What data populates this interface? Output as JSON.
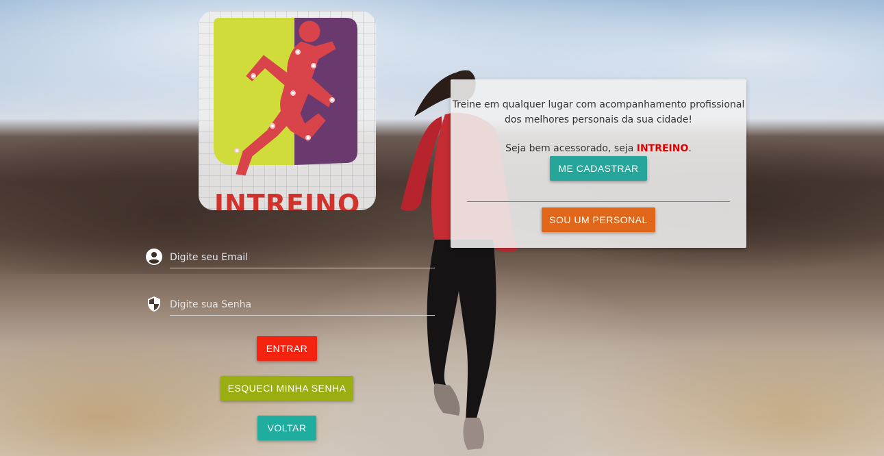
{
  "brand": {
    "logo_text": "INTREINO"
  },
  "card": {
    "tagline": "Treine em qualquer lugar com acompanhamento profissional dos melhores personais da sua cidade!",
    "welcome_prefix": "Seja bem acessorado, seja ",
    "welcome_brand": "INTREINO",
    "welcome_suffix": ".",
    "signup_label": "ME CADASTRAR",
    "personal_label": "SOU UM PERSONAL"
  },
  "login": {
    "email_placeholder": "Digite seu Email",
    "password_placeholder": "Digite sua Senha",
    "email_value": "",
    "password_value": "",
    "enter_label": "ENTRAR",
    "forgot_label": "ESQUECI MINHA SENHA",
    "back_label": "VOLTAR"
  },
  "icons": {
    "email": "account-circle-icon",
    "password": "shield-icon"
  },
  "colors": {
    "brand_red": "#d0332b",
    "enter": "#f4230f",
    "forgot": "#9aae12",
    "back": "#1fada0",
    "signup": "#26a69a",
    "personal": "#e0661a"
  }
}
